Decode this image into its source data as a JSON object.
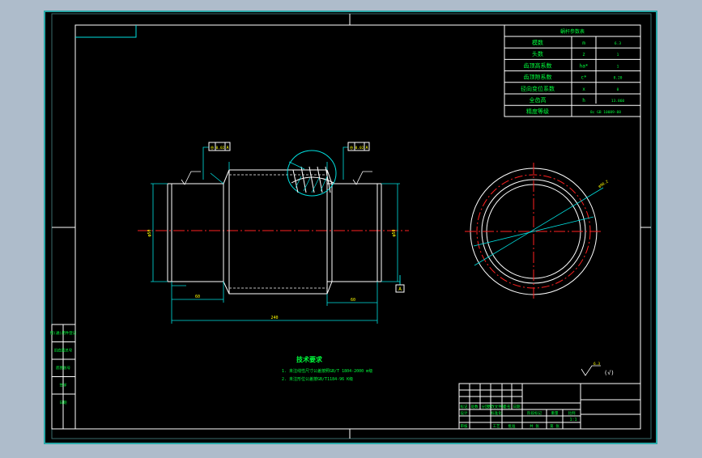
{
  "colors": {
    "background_outer": "#aebccb",
    "sheet": "#000000",
    "sheet_edge": "#2aa8a8",
    "frame_line": "#ffffff",
    "cad_cyan": "#00e0e0",
    "cad_green": "#00ff3c",
    "cad_yellow": "#ffff00",
    "centerline_red": "#ff2020"
  },
  "param_table": {
    "title": "蜗杆参数表",
    "rows": [
      {
        "name": "模数",
        "symbol": "m",
        "value": "6.3"
      },
      {
        "name": "头数",
        "symbol": "z",
        "value": "1"
      },
      {
        "name": "齿顶高系数",
        "symbol": "ha*",
        "value": "1"
      },
      {
        "name": "齿顶隙系数",
        "symbol": "c*",
        "value": "0.20"
      },
      {
        "name": "径向变位系数",
        "symbol": "x",
        "value": "0"
      },
      {
        "name": "全齿高",
        "symbol": "h",
        "value": "13.860"
      },
      {
        "name": "精度等级",
        "symbol": "",
        "value": "8c GB 10089-88"
      }
    ]
  },
  "left_strip": [
    "借(通)用件登记",
    "旧底图总号",
    "底图总号",
    "签字",
    "日期"
  ],
  "tech_req": {
    "title": "技术要求",
    "items": [
      "1. 未注线性尺寸公差按照GB/T 1804-2000 m级",
      "2. 未注形位公差按GB/T1184-96 K级"
    ]
  },
  "surface_finish": {
    "value": "6.3",
    "note": "(√)"
  },
  "gdt": {
    "left": {
      "symbol": "◎",
      "value": "0.02",
      "datum": "A"
    },
    "right": {
      "symbol": "◎",
      "value": "0.02",
      "datum": "A"
    },
    "datum_label": "A"
  },
  "title_block": {
    "row_labels": [
      "标记",
      "处数",
      "分区",
      "更改文件号",
      "签名",
      "日期"
    ],
    "labels2": [
      "设计",
      "标准化",
      "阶段标记",
      "重量",
      "比例"
    ],
    "labels3": [
      "审核",
      "工艺",
      "批准",
      "共  张",
      "第  张"
    ],
    "ratio": "1:1"
  },
  "dims": {
    "overall_length": "240",
    "left_journal": "60",
    "right_journal": "60",
    "left_dia": "φ50",
    "right_dia": "φ50",
    "ring_dia": "φ98.2"
  }
}
